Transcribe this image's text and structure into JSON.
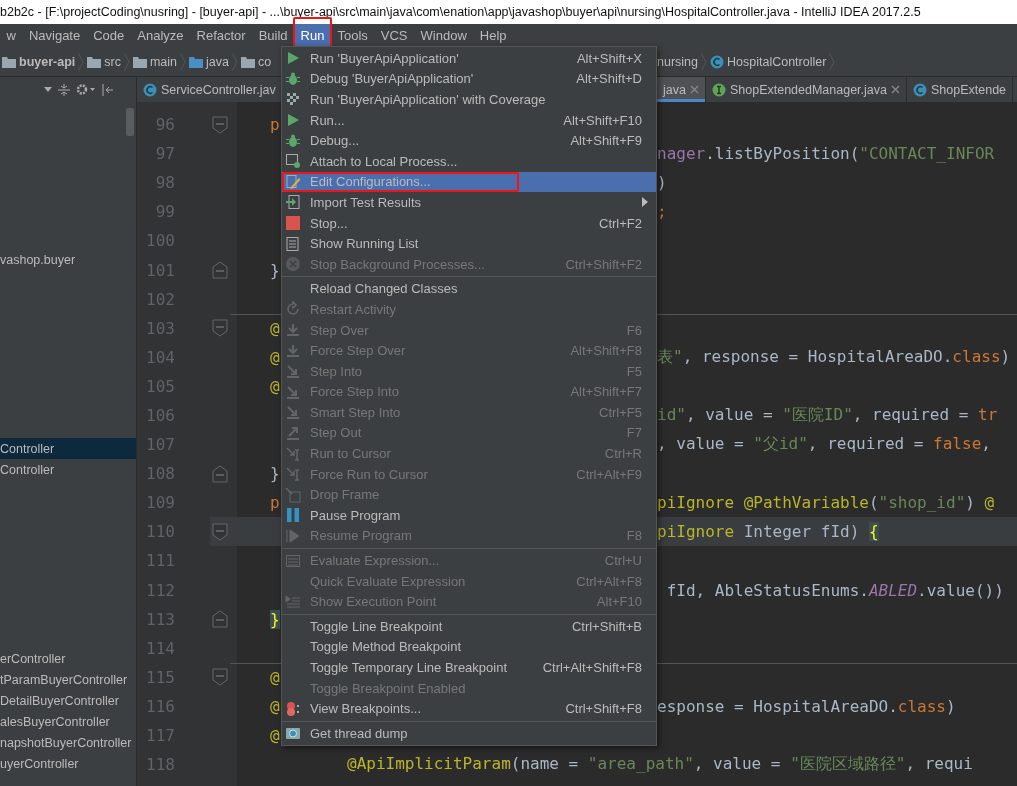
{
  "window": {
    "title": "b2b2c - [F:\\projectCoding\\nusring] - [buyer-api] - ...\\buyer-api\\src\\main\\java\\com\\enation\\app\\javashop\\buyer\\api\\nursing\\HospitalController.java - IntelliJ IDEA 2017.2.5"
  },
  "menubar": [
    {
      "label": "w",
      "selected": false,
      "annotated": false
    },
    {
      "label": "Navigate",
      "selected": false,
      "annotated": false
    },
    {
      "label": "Code",
      "selected": false,
      "annotated": false
    },
    {
      "label": "Analyze",
      "selected": false,
      "annotated": false
    },
    {
      "label": "Refactor",
      "selected": false,
      "annotated": false
    },
    {
      "label": "Build",
      "selected": false,
      "annotated": false
    },
    {
      "label": "Run",
      "selected": true,
      "annotated": true
    },
    {
      "label": "Tools",
      "selected": false,
      "annotated": false
    },
    {
      "label": "VCS",
      "selected": false,
      "annotated": false
    },
    {
      "label": "Window",
      "selected": false,
      "annotated": false
    },
    {
      "label": "Help",
      "selected": false,
      "annotated": false
    }
  ],
  "breadcrumb": {
    "left": [
      {
        "label": "buyer-api",
        "kind": "module"
      },
      {
        "label": "src",
        "kind": "folder"
      },
      {
        "label": "main",
        "kind": "folder"
      },
      {
        "label": "java",
        "kind": "source"
      },
      {
        "label": "co",
        "kind": "folder"
      }
    ],
    "right": [
      {
        "label": "nursing",
        "kind": "package"
      },
      {
        "label": "HospitalController",
        "kind": "class"
      }
    ]
  },
  "editor_tabs": {
    "left": [
      {
        "label": "ServiceController.jav",
        "kind": "class",
        "closable": false,
        "selected": false
      }
    ],
    "right": [
      {
        "label": "java",
        "kind": "file",
        "closable": true,
        "selected": true
      },
      {
        "label": "ShopExtendedManager.java",
        "kind": "interface",
        "closable": true,
        "selected": false
      },
      {
        "label": "ShopExtende",
        "kind": "class",
        "closable": false,
        "selected": false
      }
    ]
  },
  "project_tree": [
    {
      "label": "vashop.buyer",
      "selected": false
    },
    {
      "label": "Controller",
      "selected": true
    },
    {
      "label": "Controller",
      "selected": false
    },
    {
      "label": "erController",
      "selected": false
    },
    {
      "label": "tParamBuyerController",
      "selected": false
    },
    {
      "label": "DetailBuyerController",
      "selected": false
    },
    {
      "label": "alesBuyerController",
      "selected": false
    },
    {
      "label": "napshotBuyerController",
      "selected": false
    },
    {
      "label": "uyerController",
      "selected": false
    }
  ],
  "code_lines": [
    {
      "number": "96",
      "kind": "fold_start",
      "left": [
        {
          "text": "p",
          "kind": "keyword"
        }
      ]
    },
    {
      "number": "97",
      "kind": "line",
      "right": [
        {
          "text": "nager",
          "kind": "field"
        },
        {
          "text": ".listByPosition(",
          "kind": "plain"
        },
        {
          "text": "\"CONTACT_INFOR",
          "kind": "string"
        }
      ]
    },
    {
      "number": "98",
      "kind": "line",
      "right": [
        {
          "text": ")",
          "kind": "plain"
        }
      ]
    },
    {
      "number": "99",
      "kind": "line",
      "right": [
        {
          "text": ";",
          "kind": "keyword"
        }
      ]
    },
    {
      "number": "100",
      "kind": "line"
    },
    {
      "number": "101",
      "kind": "fold_end",
      "left": [
        {
          "text": "}",
          "kind": "plain"
        }
      ]
    },
    {
      "number": "102",
      "kind": "line"
    },
    {
      "number": "103",
      "kind": "fold_start",
      "divider_above": true,
      "left": [
        {
          "text": "@",
          "kind": "annotation"
        }
      ]
    },
    {
      "number": "104",
      "kind": "line",
      "left": [
        {
          "text": "@",
          "kind": "annotation"
        }
      ],
      "right": [
        {
          "text": "表\"",
          "kind": "string"
        },
        {
          "text": ", response = HospitalAreaDO.",
          "kind": "plain"
        },
        {
          "text": "class",
          "kind": "keyword"
        },
        {
          "text": ")",
          "kind": "plain"
        }
      ]
    },
    {
      "number": "105",
      "kind": "line",
      "left": [
        {
          "text": "@",
          "kind": "annotation"
        }
      ]
    },
    {
      "number": "106",
      "kind": "line",
      "right": [
        {
          "text": "id\"",
          "kind": "string"
        },
        {
          "text": ", value = ",
          "kind": "plain"
        },
        {
          "text": "\"医院ID\"",
          "kind": "string"
        },
        {
          "text": ", required = ",
          "kind": "plain"
        },
        {
          "text": "tr",
          "kind": "keyword"
        }
      ]
    },
    {
      "number": "107",
      "kind": "line",
      "right": [
        {
          "text": ", value = ",
          "kind": "plain"
        },
        {
          "text": "\"父id\"",
          "kind": "string"
        },
        {
          "text": ", required = ",
          "kind": "plain"
        },
        {
          "text": "false",
          "kind": "keyword"
        },
        {
          "text": ",",
          "kind": "plain"
        }
      ]
    },
    {
      "number": "108",
      "kind": "fold_end",
      "left": [
        {
          "text": "}",
          "kind": "plain"
        }
      ]
    },
    {
      "number": "109",
      "kind": "line",
      "left": [
        {
          "text": "p",
          "kind": "keyword"
        }
      ],
      "right": [
        {
          "text": "piIgnore @PathVariable",
          "kind": "annotation"
        },
        {
          "text": "(",
          "kind": "plain"
        },
        {
          "text": "\"shop_id\"",
          "kind": "string"
        },
        {
          "text": ") ",
          "kind": "plain"
        },
        {
          "text": "@",
          "kind": "annotation"
        }
      ]
    },
    {
      "number": "110",
      "kind": "fold_start",
      "current": true,
      "right": [
        {
          "text": "piIgnore",
          "kind": "annotation"
        },
        {
          "text": " Integer fId) ",
          "kind": "plain"
        },
        {
          "text": "{",
          "kind": "brace"
        }
      ]
    },
    {
      "number": "111",
      "kind": "line"
    },
    {
      "number": "112",
      "kind": "line",
      "right": [
        {
          "text": " fId, AbleStatusEnums.",
          "kind": "plain"
        },
        {
          "text": "ABLED",
          "kind": "constant"
        },
        {
          "text": ".value())",
          "kind": "plain"
        }
      ]
    },
    {
      "number": "113",
      "kind": "fold_end",
      "left": [
        {
          "text": "}",
          "kind": "brace"
        }
      ]
    },
    {
      "number": "114",
      "kind": "line"
    },
    {
      "number": "115",
      "kind": "fold_start",
      "divider_above": true,
      "left": [
        {
          "text": "@",
          "kind": "annotation"
        }
      ]
    },
    {
      "number": "116",
      "kind": "line",
      "left": [
        {
          "text": "@",
          "kind": "annotation"
        }
      ],
      "right": [
        {
          "text": "esponse = HospitalAreaDO.",
          "kind": "plain"
        },
        {
          "text": "class",
          "kind": "keyword"
        },
        {
          "text": ")",
          "kind": "plain"
        }
      ]
    },
    {
      "number": "117",
      "kind": "line",
      "left": [
        {
          "text": "@",
          "kind": "annotation"
        }
      ]
    },
    {
      "number": "118",
      "kind": "line",
      "indented": true,
      "left": [
        {
          "text": "@ApiImplicitParam",
          "kind": "annotation"
        },
        {
          "text": "(name = ",
          "kind": "plain"
        },
        {
          "text": "\"area_path\"",
          "kind": "string"
        },
        {
          "text": ", value = ",
          "kind": "plain"
        },
        {
          "text": "\"医院区域路径\"",
          "kind": "string"
        },
        {
          "text": ", requi",
          "kind": "plain"
        }
      ]
    }
  ],
  "run_menu": {
    "sections": [
      {
        "items": [
          {
            "label": "Run 'BuyerApiApplication'",
            "shortcut": "Alt+Shift+X",
            "kind": "run",
            "disabled": false,
            "selected": false,
            "annotated": false,
            "submenu": false
          },
          {
            "label": "Debug 'BuyerApiApplication'",
            "shortcut": "Alt+Shift+D",
            "kind": "debug",
            "disabled": false,
            "selected": false,
            "annotated": false,
            "submenu": false
          },
          {
            "label": "Run 'BuyerApiApplication' with Coverage",
            "kind": "coverage",
            "disabled": false,
            "selected": false,
            "annotated": false,
            "submenu": false
          },
          {
            "label": "Run...",
            "shortcut": "Alt+Shift+F10",
            "kind": "run",
            "disabled": false,
            "selected": false,
            "annotated": false,
            "submenu": false
          },
          {
            "label": "Debug...",
            "shortcut": "Alt+Shift+F9",
            "kind": "debug",
            "disabled": false,
            "selected": false,
            "annotated": false,
            "submenu": false
          },
          {
            "label": "Attach to Local Process...",
            "kind": "attach",
            "disabled": false,
            "selected": false,
            "annotated": false,
            "submenu": false
          },
          {
            "label": "Edit Configurations...",
            "kind": "edit",
            "disabled": false,
            "selected": true,
            "annotated": true,
            "submenu": false
          },
          {
            "label": "Import Test Results",
            "kind": "import",
            "disabled": false,
            "selected": false,
            "annotated": false,
            "submenu": true
          },
          {
            "label": "Stop...",
            "shortcut": "Ctrl+F2",
            "kind": "stop",
            "disabled": false,
            "selected": false,
            "annotated": false,
            "submenu": false
          },
          {
            "label": "Show Running List",
            "kind": "list",
            "disabled": false,
            "selected": false,
            "annotated": false,
            "submenu": false
          },
          {
            "label": "Stop Background Processes...",
            "shortcut": "Ctrl+Shift+F2",
            "kind": "cancel",
            "disabled": true,
            "selected": false,
            "annotated": false,
            "submenu": false
          }
        ]
      },
      {
        "items": [
          {
            "label": "Reload Changed Classes",
            "kind": "plain",
            "disabled": false,
            "selected": false,
            "annotated": false,
            "submenu": false
          },
          {
            "label": "Restart Activity",
            "kind": "restart",
            "disabled": true,
            "selected": false,
            "annotated": false,
            "submenu": false
          },
          {
            "label": "Step Over",
            "shortcut": "F6",
            "kind": "step_over",
            "disabled": true,
            "selected": false,
            "annotated": false,
            "submenu": false
          },
          {
            "label": "Force Step Over",
            "shortcut": "Alt+Shift+F8",
            "kind": "step_over",
            "disabled": true,
            "selected": false,
            "annotated": false,
            "submenu": false
          },
          {
            "label": "Step Into",
            "shortcut": "F5",
            "kind": "step_into",
            "disabled": true,
            "selected": false,
            "annotated": false,
            "submenu": false
          },
          {
            "label": "Force Step Into",
            "shortcut": "Alt+Shift+F7",
            "kind": "step_into",
            "disabled": true,
            "selected": false,
            "annotated": false,
            "submenu": false
          },
          {
            "label": "Smart Step Into",
            "shortcut": "Ctrl+F5",
            "kind": "step_into",
            "disabled": true,
            "selected": false,
            "annotated": false,
            "submenu": false
          },
          {
            "label": "Step Out",
            "shortcut": "F7",
            "kind": "step_out",
            "disabled": true,
            "selected": false,
            "annotated": false,
            "submenu": false
          },
          {
            "label": "Run to Cursor",
            "shortcut": "Ctrl+R",
            "kind": "cursor",
            "disabled": true,
            "selected": false,
            "annotated": false,
            "submenu": false
          },
          {
            "label": "Force Run to Cursor",
            "shortcut": "Ctrl+Alt+F9",
            "kind": "cursor",
            "disabled": true,
            "selected": false,
            "annotated": false,
            "submenu": false
          },
          {
            "label": "Drop Frame",
            "kind": "drop",
            "disabled": true,
            "selected": false,
            "annotated": false,
            "submenu": false
          },
          {
            "label": "Pause Program",
            "kind": "pause",
            "disabled": false,
            "selected": false,
            "annotated": false,
            "submenu": false
          },
          {
            "label": "Resume Program",
            "shortcut": "F8",
            "kind": "resume",
            "disabled": true,
            "selected": false,
            "annotated": false,
            "submenu": false
          }
        ]
      },
      {
        "items": [
          {
            "label": "Evaluate Expression...",
            "shortcut": "Ctrl+U",
            "kind": "calculator",
            "disabled": true,
            "selected": false,
            "annotated": false,
            "submenu": false
          },
          {
            "label": "Quick Evaluate Expression",
            "shortcut": "Ctrl+Alt+F8",
            "kind": "plain",
            "disabled": true,
            "selected": false,
            "annotated": false,
            "submenu": false
          },
          {
            "label": "Show Execution Point",
            "shortcut": "Alt+F10",
            "kind": "exec",
            "disabled": true,
            "selected": false,
            "annotated": false,
            "submenu": false
          }
        ]
      },
      {
        "items": [
          {
            "label": "Toggle Line Breakpoint",
            "shortcut": "Ctrl+Shift+B",
            "kind": "plain",
            "disabled": false,
            "selected": false,
            "annotated": false,
            "submenu": false
          },
          {
            "label": "Toggle Method Breakpoint",
            "kind": "plain",
            "disabled": false,
            "selected": false,
            "annotated": false,
            "submenu": false
          },
          {
            "label": "Toggle Temporary Line Breakpoint",
            "shortcut": "Ctrl+Alt+Shift+F8",
            "kind": "plain",
            "disabled": false,
            "selected": false,
            "annotated": false,
            "submenu": false
          },
          {
            "label": "Toggle Breakpoint Enabled",
            "kind": "plain",
            "disabled": true,
            "selected": false,
            "annotated": false,
            "submenu": false
          },
          {
            "label": "View Breakpoints...",
            "shortcut": "Ctrl+Shift+F8",
            "kind": "breakpoints",
            "disabled": false,
            "selected": false,
            "annotated": false,
            "submenu": false
          }
        ]
      },
      {
        "items": [
          {
            "label": "Get thread dump",
            "kind": "camera",
            "disabled": false,
            "selected": false,
            "annotated": false,
            "submenu": false
          }
        ]
      }
    ]
  }
}
